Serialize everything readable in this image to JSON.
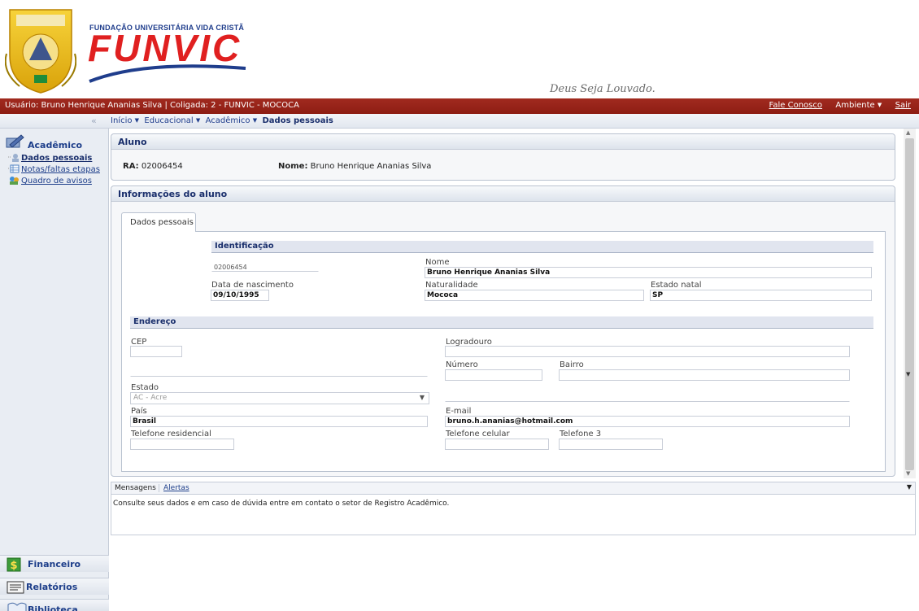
{
  "header": {
    "crest_label": "FUNVIC",
    "brand_small": "FUNDAÇÃO UNIVERSITÁRIA VIDA CRISTÃ",
    "brand_big": "FUNVIC",
    "motto": "Deus Seja Louvado."
  },
  "topbar": {
    "user_info": "Usuário: Bruno Henrique Ananias Silva  |  Coligada: 2 - FUNVIC - MOCOCA",
    "contact": "Fale Conosco",
    "environment": "Ambiente",
    "logout": "Sair"
  },
  "breadcrumb": {
    "items": [
      "Início",
      "Educacional",
      "Acadêmico"
    ],
    "current": "Dados pessoais",
    "collapse": "«"
  },
  "sidebar": {
    "section_title": "Acadêmico",
    "items": [
      {
        "label": "Dados pessoais",
        "icon": "person-icon",
        "active": true
      },
      {
        "label": "Notas/faltas etapas",
        "icon": "grid-icon",
        "active": false
      },
      {
        "label": "Quadro de avisos",
        "icon": "people-icon",
        "active": false
      }
    ],
    "bottom": [
      {
        "label": "Financeiro",
        "icon": "dollar-icon"
      },
      {
        "label": "Relatórios",
        "icon": "report-icon"
      },
      {
        "label": "Biblioteca",
        "icon": "book-icon"
      }
    ]
  },
  "aluno": {
    "title": "Aluno",
    "ra_label": "RA:",
    "ra_value": "02006454",
    "nome_label": "Nome:",
    "nome_value": "Bruno Henrique Ananias Silva"
  },
  "info": {
    "title": "Informações do aluno",
    "tab": "Dados pessoais",
    "identificacao": {
      "title": "Identificação",
      "ra": "02006454",
      "nome_label": "Nome",
      "nome": "Bruno Henrique Ananias Silva",
      "nascimento_label": "Data de nascimento",
      "nascimento": "09/10/1995",
      "naturalidade_label": "Naturalidade",
      "naturalidade": "Mococa",
      "estado_natal_label": "Estado natal",
      "estado_natal": "SP"
    },
    "endereco": {
      "title": "Endereço",
      "cep_label": "CEP",
      "cep": "",
      "logradouro_label": "Logradouro",
      "logradouro": "",
      "numero_label": "Número",
      "numero": "",
      "bairro_label": "Bairro",
      "bairro": "",
      "estado_label": "Estado",
      "estado": "AC - Acre",
      "pais_label": "País",
      "pais": "Brasil",
      "email_label": "E-mail",
      "email": "bruno.h.ananias@hotmail.com",
      "tel_res_label": "Telefone residencial",
      "tel_res": "",
      "tel_cel_label": "Telefone celular",
      "tel_cel": "",
      "tel3_label": "Telefone 3",
      "tel3": ""
    }
  },
  "messages": {
    "tabs": [
      "Mensagens",
      "Alertas"
    ],
    "text": "Consulte seus dados e em caso de dúvida entre em contato o setor de Registro Acadêmico.",
    "collapse": "▼"
  },
  "colors": {
    "topbar": "#951f15",
    "brand_red": "#e02020",
    "brand_blue": "#1f3d8c",
    "panel_header": "#dde3ec"
  }
}
